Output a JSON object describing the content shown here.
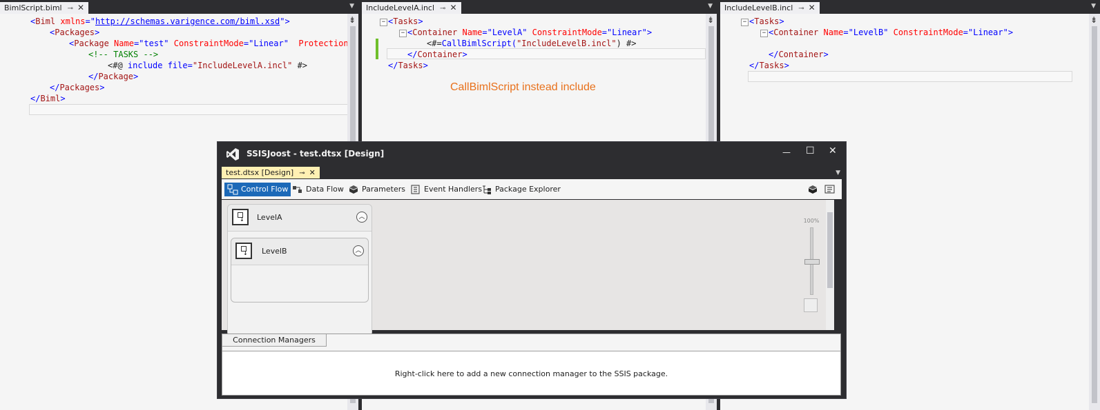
{
  "panes": [
    {
      "tab": "BimlScript.biml"
    },
    {
      "tab": "IncludeLevelA.incl"
    },
    {
      "tab": "IncludeLevelB.incl"
    }
  ],
  "pane1_lines": {
    "l1a": "<",
    "l1b": "Biml",
    "l1c": " xmlns",
    "l1d": "=\"",
    "l1e": "http://schemas.varigence.com/biml.xsd",
    "l1f": "\">",
    "l2a": "<",
    "l2b": "Packages",
    "l2c": ">",
    "l3a": "<",
    "l3b": "Package",
    "l3c": " Name",
    "l3d": "=\"test\"",
    "l3e": " ConstraintMode",
    "l3f": "=\"Linear\"",
    "l3g": "  ProtectionLev",
    "l4": "<!-- TASKS -->",
    "l5a": "<#@",
    "l5b": " include file=",
    "l5c": "\"IncludeLevelA.incl\"",
    "l5d": " #>",
    "l6a": "</",
    "l6b": "Package",
    "l6c": ">",
    "l7a": "</",
    "l7b": "Packages",
    "l7c": ">",
    "l8a": "</",
    "l8b": "Biml",
    "l8c": ">"
  },
  "pane2_lines": {
    "l1a": "<",
    "l1b": "Tasks",
    "l1c": ">",
    "l2a": "<",
    "l2b": "Container",
    "l2c": " Name",
    "l2d": "=\"LevelA\"",
    "l2e": " ConstraintMode",
    "l2f": "=\"Linear\"",
    "l2g": ">",
    "l3a": "<#=",
    "l3b": "CallBimlScript(",
    "l3c": "\"IncludeLevelB.incl\"",
    "l3d": ") #>",
    "l4a": "</",
    "l4b": "Container",
    "l4c": ">",
    "l5a": "</",
    "l5b": "Tasks",
    "l5c": ">"
  },
  "pane3_lines": {
    "l1a": "<",
    "l1b": "Tasks",
    "l1c": ">",
    "l2a": "<",
    "l2b": "Container",
    "l2c": " Name",
    "l2d": "=\"LevelB\"",
    "l2e": " ConstraintMode",
    "l2f": "=\"Linear\"",
    "l2g": ">",
    "l3a": "</",
    "l3b": "Container",
    "l3c": ">",
    "l4a": "</",
    "l4b": "Tasks",
    "l4c": ">"
  },
  "annotation": "CallBimlScript instead include",
  "dialog": {
    "title": "SSISJoost - test.dtsx [Design]",
    "doc_tab": "test.dtsx [Design]",
    "toolbar": [
      "Control Flow",
      "Data Flow",
      "Parameters",
      "Event Handlers",
      "Package Explorer"
    ],
    "zoom_label": "100%",
    "level_a": "LevelA",
    "level_b": "LevelB",
    "conn_tab": "Connection Managers",
    "conn_hint": "Right-click here to add a new connection manager to the SSIS package."
  },
  "colors": {
    "accent": "#1c69b8",
    "annotation": "#e8711c",
    "doc_tab": "#fff0b3"
  }
}
